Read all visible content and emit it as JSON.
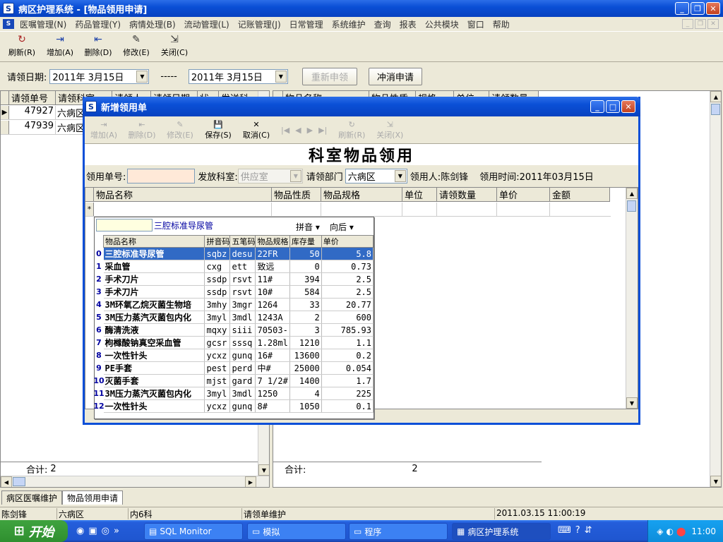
{
  "app": {
    "title": "病区护理系统 - [物品领用申请]",
    "icon_label": "S"
  },
  "menu": [
    "医嘱管理(N)",
    "药品管理(Y)",
    "病情处理(B)",
    "流动管理(L)",
    "记账管理(J)",
    "日常管理",
    "系统维护",
    "查询",
    "报表",
    "公共模块",
    "窗口",
    "帮助"
  ],
  "toolbar": [
    {
      "label": "刷新(R)",
      "icon": "refresh-icon"
    },
    {
      "label": "增加(A)",
      "icon": "add-icon"
    },
    {
      "label": "删除(D)",
      "icon": "delete-icon"
    },
    {
      "label": "修改(E)",
      "icon": "edit-icon"
    },
    {
      "label": "关闭(C)",
      "icon": "close-door-icon"
    }
  ],
  "filter": {
    "label": "请领日期:",
    "date_from": "2011年 3月15日",
    "sep": "-----",
    "date_to": "2011年 3月15日",
    "reapply": "重新申领",
    "cancel_apply": "冲消申请"
  },
  "left_grid": {
    "headers": [
      "请领单号",
      "请领科室",
      "请领人",
      "请领日期",
      "状",
      "发送科"
    ],
    "rows": [
      [
        "47927",
        "六病区"
      ],
      [
        "47939",
        "六病区"
      ]
    ],
    "total_label": "合计:",
    "total": "2"
  },
  "right_grid": {
    "headers": [
      "物品名称",
      "物品性质",
      "规格",
      "单位",
      "请领数量"
    ],
    "total_label": "合计:",
    "total": "2"
  },
  "dialog": {
    "title": "新增领用单",
    "toolbar": [
      {
        "label": "增加(A)",
        "enabled": false
      },
      {
        "label": "删除(D)",
        "enabled": false
      },
      {
        "label": "修改(E)",
        "enabled": false
      },
      {
        "label": "保存(S)",
        "enabled": true
      },
      {
        "label": "取消(C)",
        "enabled": true
      },
      {
        "label": "刷新(R)",
        "enabled": false
      },
      {
        "label": "关闭(X)",
        "enabled": false
      }
    ],
    "heading": "科室物品领用",
    "form": {
      "order_no_label": "领用单号:",
      "order_no": "",
      "dept_label": "发放科室:",
      "dept": "供应室",
      "req_dept_label": "请领部门",
      "req_dept": "六病区",
      "user_label": "领用人:",
      "user": "陈剑锋",
      "time_label": "领用时间:",
      "time": "2011年03月15日"
    },
    "grid_headers": [
      "物品名称",
      "物品性质",
      "物品规格",
      "单位",
      "请领数量",
      "单价",
      "金额"
    ],
    "new_row_marker": "*"
  },
  "popup": {
    "search_value": "",
    "current": "三腔标准导尿管",
    "mode": "拼音",
    "direction": "向后",
    "headers": [
      "物品名称",
      "拼音码",
      "五笔码",
      "物品规格",
      "库存量",
      "单价"
    ],
    "rows": [
      [
        "三腔标准导尿管",
        "sqbz",
        "desu",
        "22FR",
        "50",
        "5.8"
      ],
      [
        "采血管",
        "cxg",
        "ett",
        "致远",
        "0",
        "0.73"
      ],
      [
        "手术刀片",
        "ssdp",
        "rsvt",
        "11#",
        "394",
        "2.5"
      ],
      [
        "手术刀片",
        "ssdp",
        "rsvt",
        "10#",
        "584",
        "2.5"
      ],
      [
        "3M环氧乙烷灭菌生物培",
        "3mhy",
        "3mgr",
        "1264",
        "33",
        "20.77"
      ],
      [
        "3M压力蒸汽灭菌包内化",
        "3myl",
        "3mdl",
        "1243A",
        "2",
        "600"
      ],
      [
        "酶清洗液",
        "mqxy",
        "siii",
        "70503-",
        "3",
        "785.93"
      ],
      [
        "枸橼酸钠真空采血管",
        "gcsr",
        "sssq",
        "1.28ml",
        "1210",
        "1.1"
      ],
      [
        "一次性针头",
        "ycxz",
        "gunq",
        "16#",
        "13600",
        "0.2"
      ],
      [
        "PE手套",
        "pest",
        "perd",
        "中#",
        "25000",
        "0.054"
      ],
      [
        "灭菌手套",
        "mjst",
        "gard",
        "7 1/2#",
        "1400",
        "1.7"
      ],
      [
        "3M压力蒸汽灭菌包内化",
        "3myl",
        "3mdl",
        "1250",
        "4",
        "225"
      ],
      [
        "一次性针头",
        "ycxz",
        "gunq",
        "8#",
        "1050",
        "0.1"
      ]
    ],
    "row_numbers": [
      "0",
      "1",
      "2",
      "3",
      "4",
      "5",
      "6",
      "7",
      "8",
      "9",
      "10",
      "11",
      "12"
    ]
  },
  "bottom_tabs": [
    "病区医嘱维护",
    "物品领用申请"
  ],
  "status": {
    "user": "陈剑锋",
    "ward": "六病区",
    "dept": "内6科",
    "module": "请领单维护",
    "datetime": "2011.03.15 11:00:19"
  },
  "taskbar": {
    "start": "开始",
    "items": [
      "SQL Monitor",
      "模拟",
      "程序",
      "病区护理系统"
    ],
    "clock": "11:00"
  }
}
